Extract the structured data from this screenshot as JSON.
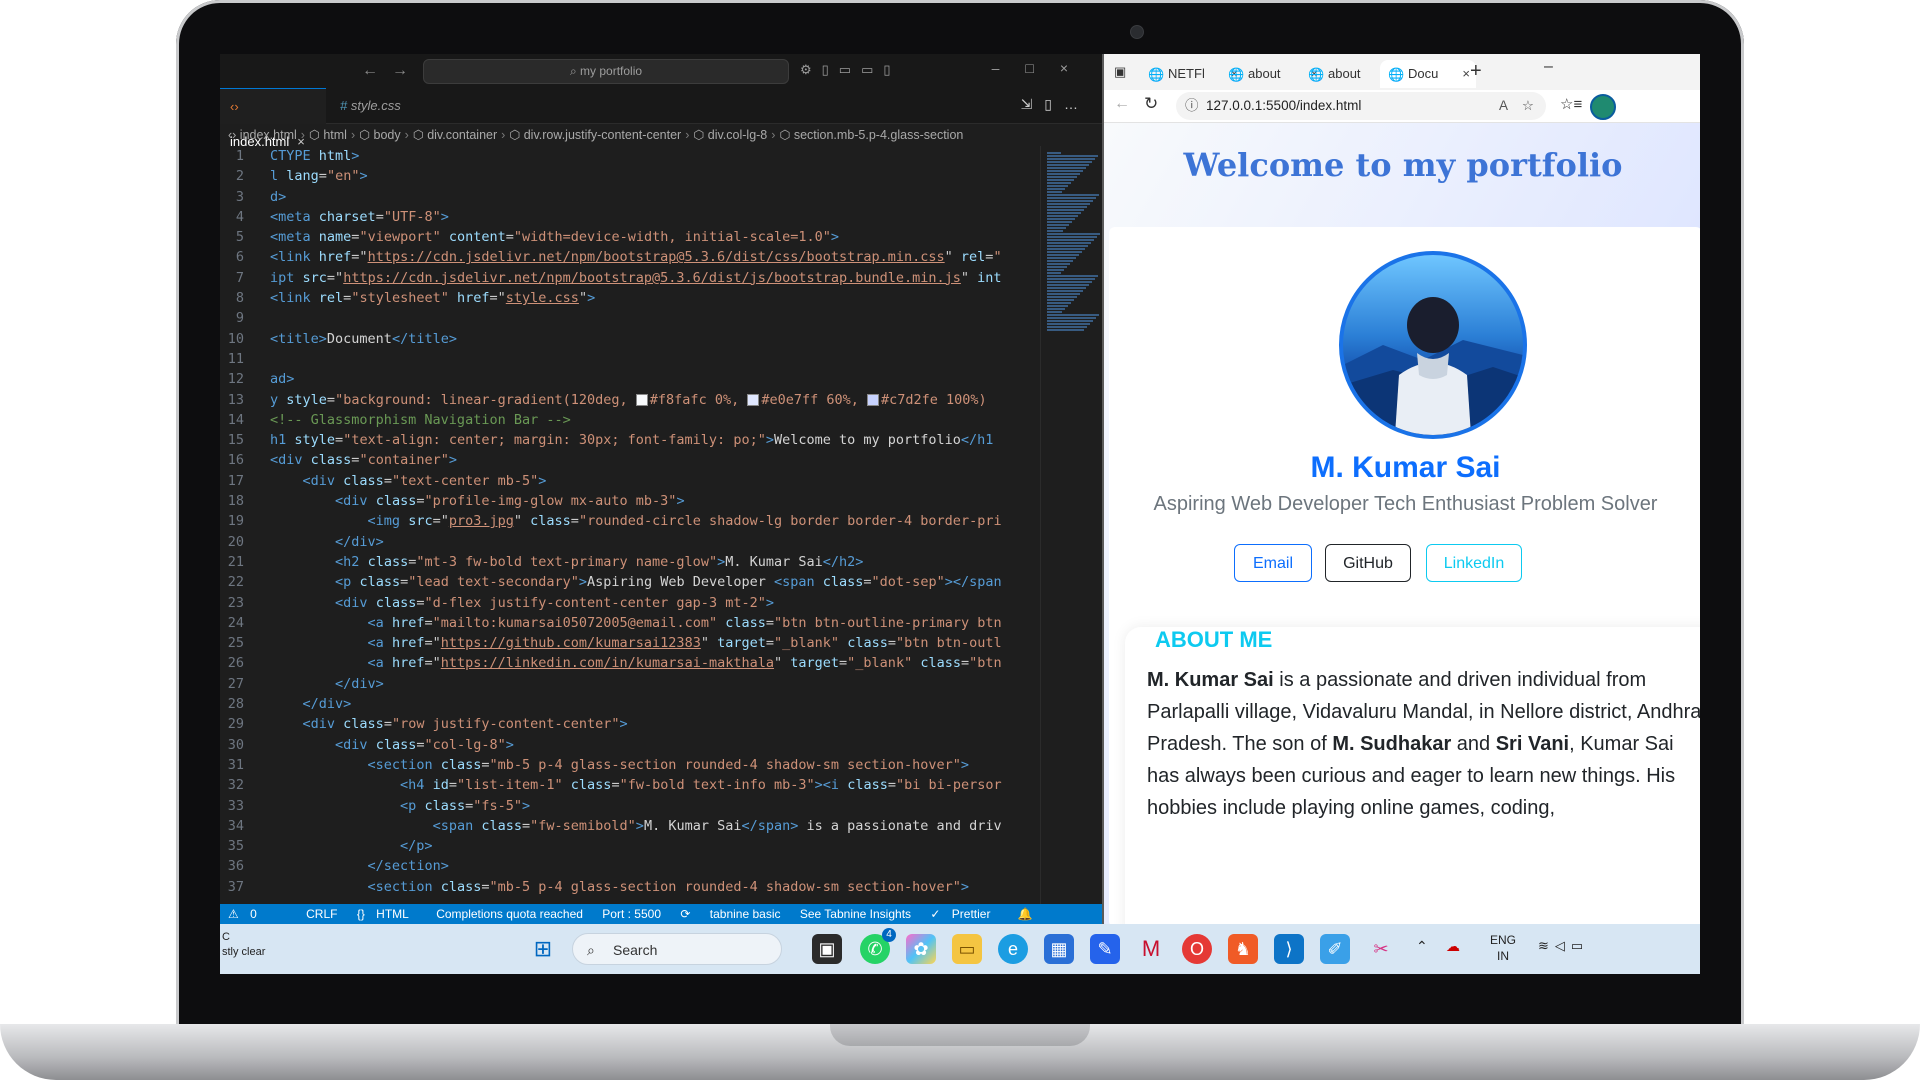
{
  "vscode": {
    "search_placeholder": "my portfolio",
    "tabs": [
      {
        "label": "index.html",
        "active": true
      },
      {
        "label": "style.css",
        "active": false
      }
    ],
    "breadcrumb": [
      "index.html",
      "html",
      "body",
      "div.container",
      "div.row.justify-content-center",
      "div.col-lg-8",
      "section.mb-5.p-4.glass-section"
    ],
    "code_lines": [
      {
        "n": "1",
        "html": "<span class='t-tag'>CTYPE</span> <span class='t-attr'>html</span><span class='t-tag'>&gt;</span>"
      },
      {
        "n": "2",
        "html": "<span class='t-tag'>l</span> <span class='t-attr'>lang</span>=<span class='t-str'>\"en\"</span><span class='t-tag'>&gt;</span>"
      },
      {
        "n": "3",
        "html": "<span class='t-tag'>d&gt;</span>"
      },
      {
        "n": "4",
        "html": "<span class='t-tag'>&lt;meta</span> <span class='t-attr'>charset</span>=<span class='t-str'>\"UTF-8\"</span><span class='t-tag'>&gt;</span>"
      },
      {
        "n": "5",
        "html": "<span class='t-tag'>&lt;meta</span> <span class='t-attr'>name</span>=<span class='t-str'>\"viewport\"</span> <span class='t-attr'>content</span>=<span class='t-str'>\"width=device-width, initial-scale=1.0\"</span><span class='t-tag'>&gt;</span>"
      },
      {
        "n": "6",
        "html": "<span class='t-tag'>&lt;link</span> <span class='t-attr'>href</span>=\"<span class='t-url'>https://cdn.jsdelivr.net/npm/bootstrap@5.3.6/dist/css/bootstrap.min.css</span>\" <span class='t-attr'>rel</span>=<span class='t-str'>\"</span>"
      },
      {
        "n": "7",
        "html": "<span class='t-tag'>ipt</span> <span class='t-attr'>src</span>=\"<span class='t-url'>https://cdn.jsdelivr.net/npm/bootstrap@5.3.6/dist/js/bootstrap.bundle.min.js</span>\" <span class='t-attr'>int</span>"
      },
      {
        "n": "8",
        "html": "<span class='t-tag'>&lt;link</span> <span class='t-attr'>rel</span>=<span class='t-str'>\"stylesheet\"</span> <span class='t-attr'>href</span>=\"<span class='t-url'>style.css</span>\"<span class='t-tag'>&gt;</span>"
      },
      {
        "n": "9",
        "html": ""
      },
      {
        "n": "10",
        "html": "<span class='t-tag'>&lt;title&gt;</span><span class='t-txt'>Document</span><span class='t-tag'>&lt;/title&gt;</span>"
      },
      {
        "n": "11",
        "html": ""
      },
      {
        "n": "12",
        "html": "<span class='t-tag'>ad&gt;</span>"
      },
      {
        "n": "13",
        "html": "<span class='t-tag'>y</span> <span class='t-attr'>style</span>=<span class='t-str'>\"background: linear-gradient(120deg, <span class='swatch' style='background:#f8fafc'></span>#f8fafc 0%, <span class='swatch' style='background:#e0e7ff'></span>#e0e7ff 60%, <span class='swatch' style='background:#c7d2fe'></span>#c7d2fe 100%)</span>"
      },
      {
        "n": "14",
        "html": "<span class='t-cmt'>&lt;!-- Glassmorphism Navigation Bar --&gt;</span>"
      },
      {
        "n": "15",
        "html": "<span class='t-tag'>h1</span> <span class='t-attr'>style</span>=<span class='t-str'>\"text-align: center; margin: 30px; font-family: po;\"</span><span class='t-tag'>&gt;</span><span class='t-txt'>Welcome to my portfolio</span><span class='t-tag'>&lt;/h1</span>"
      },
      {
        "n": "16",
        "html": "<span class='t-tag'>&lt;div</span> <span class='t-attr'>class</span>=<span class='t-str'>\"container\"</span><span class='t-tag'>&gt;</span>"
      },
      {
        "n": "17",
        "html": "    <span class='t-tag'>&lt;div</span> <span class='t-attr'>class</span>=<span class='t-str'>\"text-center mb-5\"</span><span class='t-tag'>&gt;</span>"
      },
      {
        "n": "18",
        "html": "        <span class='t-tag'>&lt;div</span> <span class='t-attr'>class</span>=<span class='t-str'>\"profile-img-glow mx-auto mb-3\"</span><span class='t-tag'>&gt;</span>"
      },
      {
        "n": "19",
        "html": "            <span class='t-tag'>&lt;img</span> <span class='t-attr'>src</span>=\"<span class='t-url'>pro3.jpg</span>\" <span class='t-attr'>class</span>=<span class='t-str'>\"rounded-circle shadow-lg border border-4 border-pri</span>"
      },
      {
        "n": "20",
        "html": "        <span class='t-tag'>&lt;/div&gt;</span>"
      },
      {
        "n": "21",
        "html": "        <span class='t-tag'>&lt;h2</span> <span class='t-attr'>class</span>=<span class='t-str'>\"mt-3 fw-bold text-primary name-glow\"</span><span class='t-tag'>&gt;</span><span class='t-txt'>M. Kumar Sai</span><span class='t-tag'>&lt;/h2&gt;</span>"
      },
      {
        "n": "22",
        "html": "        <span class='t-tag'>&lt;p</span> <span class='t-attr'>class</span>=<span class='t-str'>\"lead text-secondary\"</span><span class='t-tag'>&gt;</span><span class='t-txt'>Aspiring Web Developer </span><span class='t-tag'>&lt;span</span> <span class='t-attr'>class</span>=<span class='t-str'>\"dot-sep\"</span><span class='t-tag'>&gt;&lt;/span</span>"
      },
      {
        "n": "23",
        "html": "        <span class='t-tag'>&lt;div</span> <span class='t-attr'>class</span>=<span class='t-str'>\"d-flex justify-content-center gap-3 mt-2\"</span><span class='t-tag'>&gt;</span>"
      },
      {
        "n": "24",
        "html": "            <span class='t-tag'>&lt;a</span> <span class='t-attr'>href</span>=<span class='t-str'>\"mailto:kumarsai05072005@email.com\"</span> <span class='t-attr'>class</span>=<span class='t-str'>\"btn btn-outline-primary btn</span>"
      },
      {
        "n": "25",
        "html": "            <span class='t-tag'>&lt;a</span> <span class='t-attr'>href</span>=\"<span class='t-url'>https://github.com/kumarsai12383</span>\" <span class='t-attr'>target</span>=<span class='t-str'>\"_blank\"</span> <span class='t-attr'>class</span>=<span class='t-str'>\"btn btn-outl</span>"
      },
      {
        "n": "26",
        "html": "            <span class='t-tag'>&lt;a</span> <span class='t-attr'>href</span>=\"<span class='t-url'>https://linkedin.com/in/kumarsai-makthala</span>\" <span class='t-attr'>target</span>=<span class='t-str'>\"_blank\"</span> <span class='t-attr'>class</span>=<span class='t-str'>\"btn</span>"
      },
      {
        "n": "27",
        "html": "        <span class='t-tag'>&lt;/div&gt;</span>"
      },
      {
        "n": "28",
        "html": "    <span class='t-tag'>&lt;/div&gt;</span>"
      },
      {
        "n": "29",
        "html": "    <span class='t-tag'>&lt;div</span> <span class='t-attr'>class</span>=<span class='t-str'>\"row justify-content-center\"</span><span class='t-tag'>&gt;</span>"
      },
      {
        "n": "30",
        "html": "        <span class='t-tag'>&lt;div</span> <span class='t-attr'>class</span>=<span class='t-str'>\"col-lg-8\"</span><span class='t-tag'>&gt;</span>"
      },
      {
        "n": "31",
        "html": "            <span class='t-tag'>&lt;section</span> <span class='t-attr'>class</span>=<span class='t-str'>\"mb-5 p-4 glass-section rounded-4 shadow-sm section-hover\"</span><span class='t-tag'>&gt;</span>"
      },
      {
        "n": "32",
        "html": "                <span class='t-tag'>&lt;h4</span> <span class='t-attr'>id</span>=<span class='t-str'>\"list-item-1\"</span> <span class='t-attr'>class</span>=<span class='t-str'>\"fw-bold text-info mb-3\"</span><span class='t-tag'>&gt;&lt;i</span> <span class='t-attr'>class</span>=<span class='t-str'>\"bi bi-persor</span>"
      },
      {
        "n": "33",
        "html": "                <span class='t-tag'>&lt;p</span> <span class='t-attr'>class</span>=<span class='t-str'>\"fs-5\"</span><span class='t-tag'>&gt;</span>"
      },
      {
        "n": "34",
        "html": "                    <span class='t-tag'>&lt;span</span> <span class='t-attr'>class</span>=<span class='t-str'>\"fw-semibold\"</span><span class='t-tag'>&gt;</span><span class='t-txt'>M. Kumar Sai</span><span class='t-tag'>&lt;/span&gt;</span><span class='t-txt'> is a passionate and driv</span>"
      },
      {
        "n": "35",
        "html": "                <span class='t-tag'>&lt;/p&gt;</span>"
      },
      {
        "n": "36",
        "html": "            <span class='t-tag'>&lt;/section&gt;</span>"
      },
      {
        "n": "37",
        "html": "            <span class='t-tag'>&lt;section</span> <span class='t-attr'>class</span>=<span class='t-str'>\"mb-5 p-4 glass-section rounded-4 shadow-sm section-hover\"</span><span class='t-tag'>&gt;</span>"
      }
    ],
    "status": {
      "errors": "0",
      "eol": "CRLF",
      "language": "HTML",
      "completions": "Completions quota reached",
      "port": "Port : 5500",
      "tabnine": "tabnine basic",
      "insights": "See Tabnine Insights",
      "prettier": "Prettier"
    }
  },
  "browser": {
    "tabs": [
      {
        "label": "NETFl"
      },
      {
        "label": "about"
      },
      {
        "label": "about"
      },
      {
        "label": "Docu"
      }
    ],
    "url": "127.0.0.1:5500/index.html",
    "page": {
      "heading": "Welcome to my portfolio",
      "name": "M. Kumar Sai",
      "tagline": "Aspiring Web Developer Tech Enthusiast Problem Solver",
      "buttons": {
        "email": "Email",
        "github": "GitHub",
        "linkedin": "LinkedIn"
      },
      "about_title": "ABOUT ME",
      "about_name": "M. Kumar Sai",
      "about_text_1": " is a passionate and driven individual from Parlapalli village, Vidavaluru Mandal, in Nellore district, Andhra Pradesh. The son of ",
      "father": "M. Sudhakar",
      "and_text": " and ",
      "mother": "Sri Vani",
      "about_text_2": ", Kumar Sai has always been curious and eager to learn new things. His hobbies include playing online games, coding,"
    }
  },
  "taskbar": {
    "widget_line1": "C",
    "widget_line2": "stly clear",
    "search": "Search",
    "lang": "ENG",
    "region": "IN",
    "whatsapp_badge": "4"
  },
  "colors": {
    "vscode_status": "#007acc",
    "primary": "#0d6efd",
    "info": "#0dcaf0"
  }
}
